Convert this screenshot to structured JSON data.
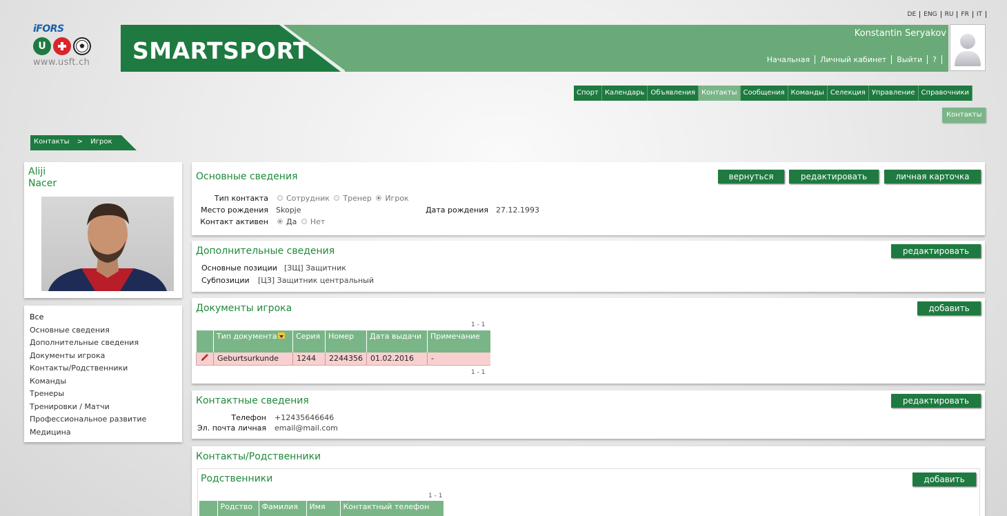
{
  "logo": {
    "brand": "iFORS",
    "badge_u": "U",
    "url": "www.usft.ch"
  },
  "languages": [
    "DE",
    "ENG",
    "RU",
    "FR",
    "IT"
  ],
  "header": {
    "app_title": "SMARTSPORT",
    "user_name": "Konstantin Seryakov",
    "links": [
      "Начальная",
      "Личный кабинет",
      "Выйти",
      "?"
    ]
  },
  "main_nav": {
    "items": [
      "Спорт",
      "Календарь",
      "Объявления",
      "Контакты",
      "Сообщения",
      "Команды",
      "Селекция",
      "Управление",
      "Справочники"
    ],
    "active": "Контакты"
  },
  "sub_nav": {
    "item": "Контакты"
  },
  "breadcrumb": {
    "parent": "Контакты",
    "separator": ">",
    "current": "Игрок"
  },
  "profile": {
    "first_name": "Aliji",
    "last_name": "Nacer"
  },
  "left_menu": [
    "Все",
    "Основные сведения",
    "Дополнительные сведения",
    "Документы игрока",
    "Контакты/Родственники",
    "Команды",
    "Тренеры",
    "Тренировки / Матчи",
    "Профессиональное развитие",
    "Медицина"
  ],
  "basic": {
    "title": "Основные сведения",
    "btn_back": "вернуться",
    "btn_edit": "редактировать",
    "btn_card": "личная карточка",
    "contact_type_label": "Тип контакта",
    "contact_type_options": [
      "Сотрудник",
      "Тренер",
      "Игрок"
    ],
    "contact_type_selected": "Игрок",
    "birthplace_label": "Место рождения",
    "birthplace": "Skopje",
    "birthdate_label": "Дата рождения",
    "birthdate": "27.12.1993",
    "active_label": "Контакт активен",
    "active_options": [
      "Да",
      "Нет"
    ],
    "active_selected": "Да"
  },
  "additional": {
    "title": "Дополнительные сведения",
    "btn_edit": "редактировать",
    "positions_label": "Основные позиции",
    "positions": "[ЗЩ] Защитник",
    "subpositions_label": "Субпозиции",
    "subpositions": "[ЦЗ] Защитник центральный"
  },
  "documents": {
    "title": "Документы игрока",
    "btn_add": "добавить",
    "pager": "1 - 1",
    "columns": [
      "Тип документа",
      "Серия",
      "Номер",
      "Дата выдачи",
      "Примечание"
    ],
    "rows": [
      [
        "Geburtsurkunde",
        "1244",
        "2244356",
        "01.02.2016",
        "-"
      ]
    ]
  },
  "contact_info": {
    "title": "Контактные сведения",
    "btn_edit": "редактировать",
    "phone_label": "Телефон",
    "phone": "+12435646646",
    "email_label": "Эл. почта личная",
    "email": "email@mail.com"
  },
  "relatives_section": {
    "title": "Контакты/Родственники",
    "sub_title": "Родственники",
    "btn_add": "добавить",
    "pager": "1 - 1",
    "columns": [
      "Родство",
      "Фамилия",
      "Имя",
      "Контактный телефон"
    ]
  },
  "colors": {
    "dark_green": "#1e7a40",
    "mid_green": "#6aaa78",
    "light_green": "#7ab587",
    "row_pink": "#f8d0d0"
  }
}
